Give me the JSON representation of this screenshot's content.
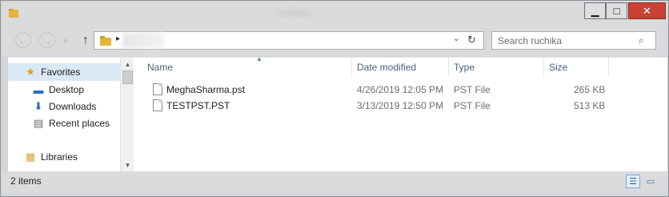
{
  "window": {
    "title": "ruchika",
    "controls": {
      "minimize": "▁",
      "maximize": "□",
      "close": "✕"
    }
  },
  "toolbar": {
    "back": "←",
    "forward": "→",
    "recent": "▾",
    "up": "↑",
    "address_arrow": "▸",
    "address_dropdown": "⌄",
    "refresh": "↻",
    "search_placeholder": "Search ruchika",
    "search_glyph": "⌕"
  },
  "sidebar": {
    "items": [
      {
        "label": "Favorites",
        "icon": "star-icon",
        "glyph": "★",
        "color": "#e8a11b"
      },
      {
        "label": "Desktop",
        "icon": "desktop-icon",
        "glyph": "▬",
        "color": "#2a6cc0"
      },
      {
        "label": "Downloads",
        "icon": "downloads-icon",
        "glyph": "⬇",
        "color": "#2a6cc0"
      },
      {
        "label": "Recent places",
        "icon": "recent-places-icon",
        "glyph": "▤",
        "color": "#6a6a6a"
      },
      {
        "label": "Libraries",
        "icon": "libraries-icon",
        "glyph": "▦",
        "color": "#d6a53a"
      }
    ],
    "scroll_up": "▴",
    "scroll_down": "▾"
  },
  "columns": {
    "name": "Name",
    "date": "Date modified",
    "type": "Type",
    "size": "Size",
    "sort_glyph": "▲"
  },
  "files": [
    {
      "name": "MeghaSharma.pst",
      "date": "4/26/2019 12:05 PM",
      "type": "PST File",
      "size": "265 KB"
    },
    {
      "name": "TESTPST.PST",
      "date": "3/13/2019 12:50 PM",
      "type": "PST File",
      "size": "513 KB"
    }
  ],
  "status": {
    "item_count": "2 items",
    "details_glyph": "☰",
    "tiles_glyph": "▭"
  },
  "colors": {
    "close_button": "#c94134",
    "accent": "#2a6cc0",
    "selection": "#dbe8f6",
    "column_header_text": "#4c607a",
    "folder": "#e6b43c"
  }
}
